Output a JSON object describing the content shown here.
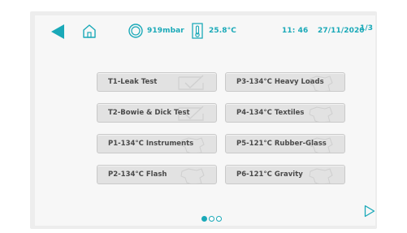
{
  "status_bar": {
    "pressure": "919mbar",
    "temperature": "25.8°C",
    "time": "11: 46",
    "date": "27/11/2020",
    "page_indicator": "1/3"
  },
  "icons": {
    "back": "back-arrow-icon",
    "home": "home-icon",
    "pressure": "pressure-gauge-icon",
    "temperature": "thermometer-icon",
    "next": "next-arrow-icon"
  },
  "programs": [
    {
      "label": "T1-Leak Test",
      "mark": "check"
    },
    {
      "label": "P3-134°C Heavy Loads",
      "mark": "cloth"
    },
    {
      "label": "T2-Bowie & Dick Test",
      "mark": "check"
    },
    {
      "label": "P4-134°C Textiles",
      "mark": "cloth"
    },
    {
      "label": "P1-134°C Instruments",
      "mark": "cloth"
    },
    {
      "label": "P5-121°C Rubber-Glass",
      "mark": "cloth"
    },
    {
      "label": "P2-134°C Flash",
      "mark": "cloth"
    },
    {
      "label": "P6-121°C  Gravity",
      "mark": "cloth"
    }
  ],
  "pagination": {
    "total": 3,
    "active": 1
  },
  "colors": {
    "accent": "#1aa9b8",
    "button_bg": "#e2e2e2",
    "text": "#4a4a4a"
  }
}
